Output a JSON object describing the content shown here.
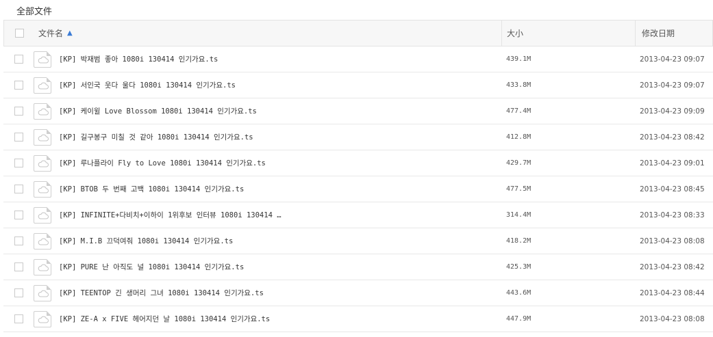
{
  "breadcrumb": "全部文件",
  "columns": {
    "name": "文件名",
    "size": "大小",
    "modified": "修改日期"
  },
  "files": [
    {
      "name": "[KP] 박재범 좋아 1080i 130414 인기가요.ts",
      "size": "439.1M",
      "date": "2013-04-23 09:07"
    },
    {
      "name": "[KP] 서인국 웃다 울다 1080i 130414 인기가요.ts",
      "size": "433.8M",
      "date": "2013-04-23 09:07"
    },
    {
      "name": "[KP] 케이윌 Love Blossom 1080i 130414 인기가요.ts",
      "size": "477.4M",
      "date": "2013-04-23 09:09"
    },
    {
      "name": "[KP] 길구봉구 미칠 것 같아 1080i 130414 인기가요.ts",
      "size": "412.8M",
      "date": "2013-04-23 08:42"
    },
    {
      "name": "[KP] 루나플라이 Fly to Love 1080i 130414 인기가요.ts",
      "size": "429.7M",
      "date": "2013-04-23 09:01"
    },
    {
      "name": "[KP] BTOB 두 번째 고백 1080i 130414 인기가요.ts",
      "size": "477.5M",
      "date": "2013-04-23 08:45"
    },
    {
      "name": "[KP] INFINITE+다비치+이하이 1위후보 인터뷰 1080i 130414 …",
      "size": "314.4M",
      "date": "2013-04-23 08:33"
    },
    {
      "name": "[KP] M.I.B 끄덕여줘 1080i 130414 인기가요.ts",
      "size": "418.2M",
      "date": "2013-04-23 08:08"
    },
    {
      "name": "[KP] PURE 난 아직도 널 1080i 130414 인기가요.ts",
      "size": "425.3M",
      "date": "2013-04-23 08:42"
    },
    {
      "name": "[KP] TEENTOP 긴 생머리 그녀 1080i 130414 인기가요.ts",
      "size": "443.6M",
      "date": "2013-04-23 08:44"
    },
    {
      "name": "[KP] ZE-A x FIVE 헤어지던 날 1080i 130414 인기가요.ts",
      "size": "447.9M",
      "date": "2013-04-23 08:08"
    }
  ]
}
